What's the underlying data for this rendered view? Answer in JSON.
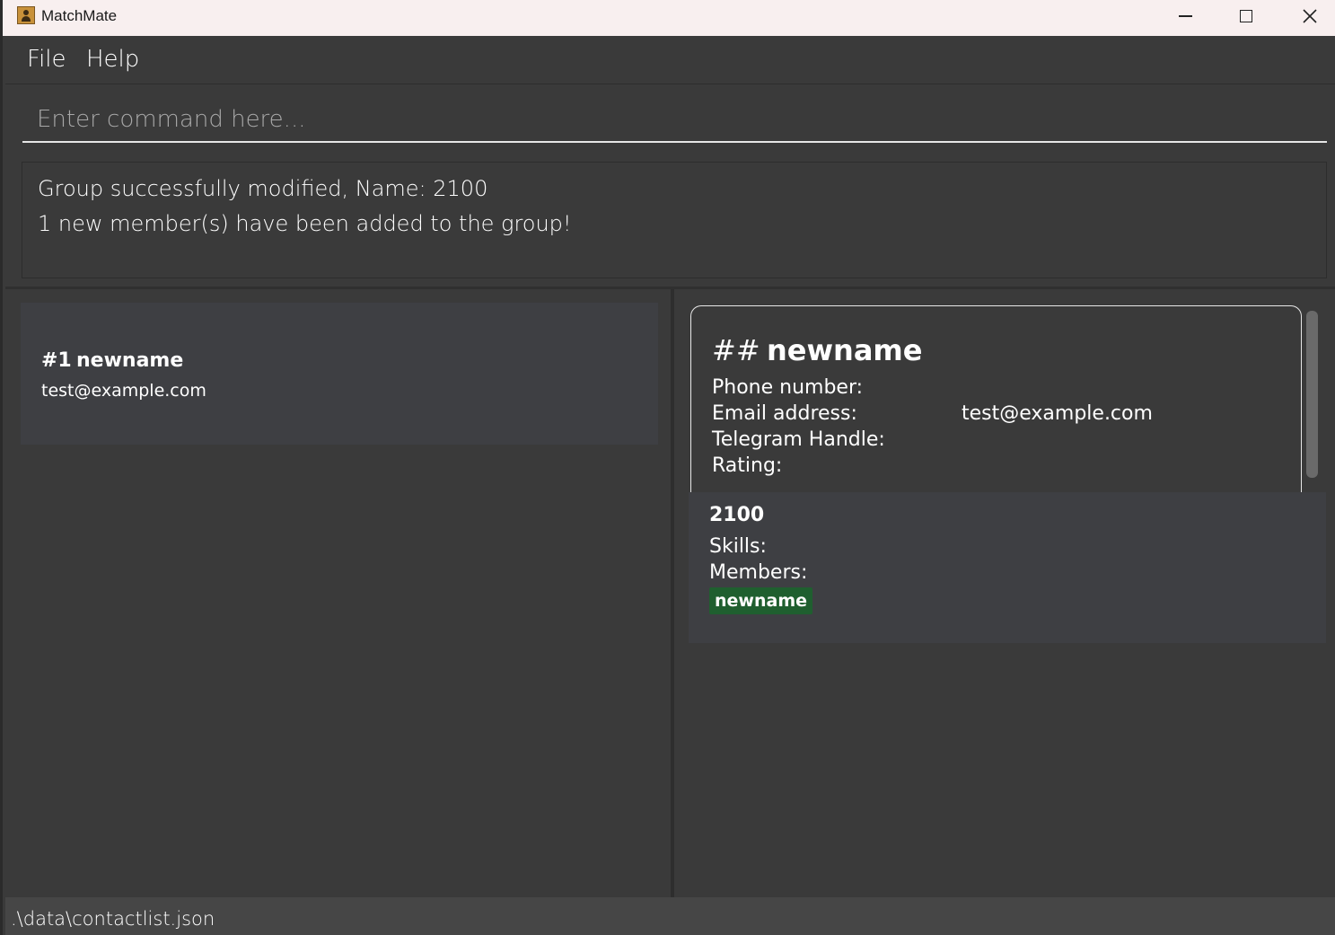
{
  "window": {
    "title": "MatchMate",
    "controls": {
      "minimize": "minimize-icon",
      "maximize": "maximize-icon",
      "close": "close-icon"
    }
  },
  "menu": {
    "file_label": "File",
    "help_label": "Help"
  },
  "command": {
    "value": "",
    "placeholder": "Enter command here..."
  },
  "result": {
    "line1": "Group successfully modified, Name: 2100",
    "line2": "1 new member(s) have been added to the group!"
  },
  "contact_list": [
    {
      "index": "#1",
      "name": "newname",
      "email": "test@example.com"
    }
  ],
  "detail": {
    "hash": "##",
    "name": "newname",
    "phone_label": "Phone number:",
    "phone_value": "",
    "email_label": "Email address:",
    "email_value": "test@example.com",
    "telegram_label": "Telegram Handle:",
    "telegram_value": "",
    "rating_label": "Rating:",
    "rating_value": ""
  },
  "group": {
    "name": "2100",
    "skills_label": "Skills:",
    "members_label": "Members:",
    "members": [
      "newname"
    ],
    "member_tag_color": "#1f5f2f"
  },
  "status": {
    "path": ".\\data\\contactlist.json"
  }
}
